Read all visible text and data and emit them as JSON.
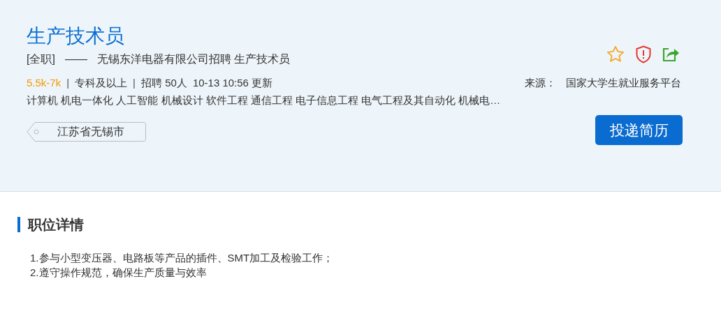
{
  "job": {
    "title": "生产技术员",
    "employment_type": "[全职]",
    "separator": "——",
    "company_line": "无锡东洋电器有限公司招聘 生产技术员",
    "salary": "5.5k-7k",
    "meta_separators": [
      "|",
      "|"
    ],
    "education": "专科及以上",
    "headcount": "招聘 50人",
    "updated": "10-13 10:56 更新",
    "source_label": "来源：",
    "source": "国家大学生就业服务平台",
    "majors": "计算机 机电一体化 人工智能 机械设计 软件工程 通信工程 电子信息工程 电气工程及其自动化 机械电…",
    "location": "江苏省无锡市",
    "apply_button": "投递简历",
    "favorited": false
  },
  "details": {
    "heading": "职位详情",
    "lines": [
      "1.参与小型变压器、电路板等产品的插件、SMT加工及检验工作；",
      "2.遵守操作规范，确保生产质量与效率"
    ]
  }
}
